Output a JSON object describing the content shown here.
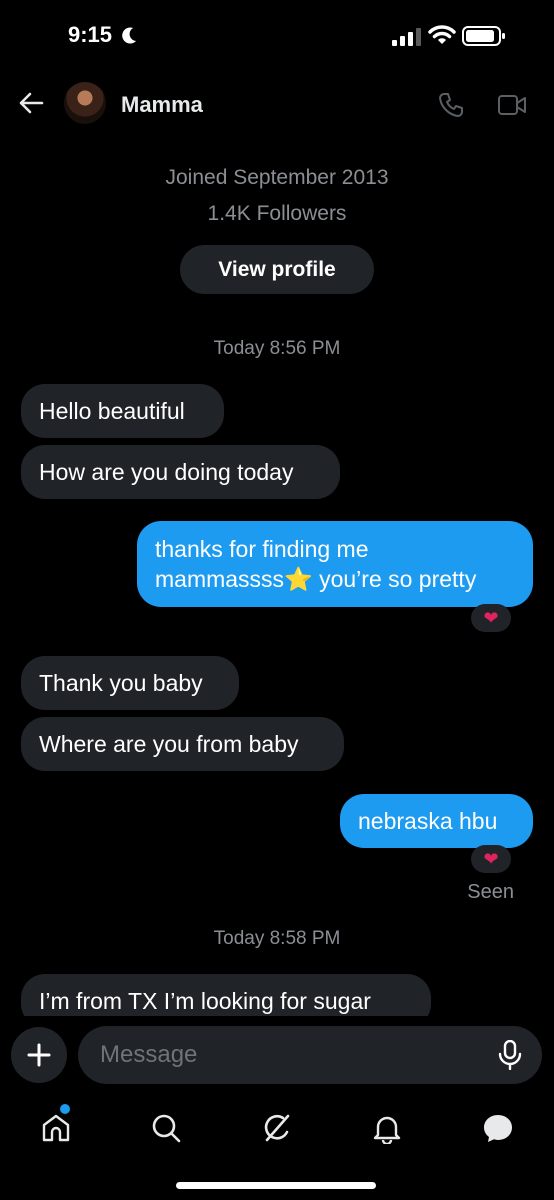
{
  "status_bar": {
    "time": "9:15"
  },
  "header": {
    "name": "Mamma"
  },
  "profile": {
    "joined": "Joined September 2013",
    "followers": "1.4K Followers",
    "view_profile_label": "View profile"
  },
  "conversation": {
    "timestamp_1": "Today 8:56 PM",
    "msg_1": "Hello beautiful",
    "msg_2": "How are you doing today",
    "msg_3_line1": "thanks for finding me",
    "msg_3_line2": "mammassss⭐ you’re so pretty",
    "reaction_1": "❤",
    "msg_4": "Thank you baby",
    "msg_5": "Where are you from baby",
    "msg_6": "nebraska hbu",
    "reaction_2": "❤",
    "seen": "Seen",
    "timestamp_2": "Today 8:58 PM",
    "msg_7": "I’m from TX I’m looking for sugar"
  },
  "composer": {
    "placeholder": "Message"
  },
  "tabs": [
    {
      "icon": "home-icon"
    },
    {
      "icon": "search-icon"
    },
    {
      "icon": "grok-icon"
    },
    {
      "icon": "bell-icon"
    },
    {
      "icon": "messages-icon"
    }
  ],
  "colors": {
    "accent": "#1d9bf0",
    "incoming_bubble": "#202327",
    "muted_text": "#8b8f94",
    "reaction_heart": "#e0245e"
  }
}
